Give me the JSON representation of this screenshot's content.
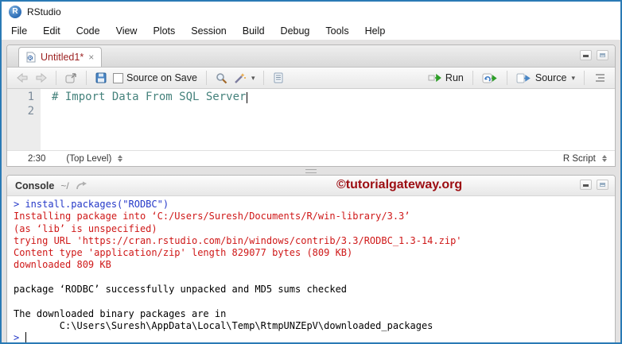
{
  "window": {
    "title": "RStudio"
  },
  "menu": {
    "items": [
      "File",
      "Edit",
      "Code",
      "View",
      "Plots",
      "Session",
      "Build",
      "Debug",
      "Tools",
      "Help"
    ]
  },
  "source_pane": {
    "tab": {
      "label": "Untitled1*",
      "close_glyph": "×"
    },
    "toolbar": {
      "source_on_save_label": "Source on Save",
      "run_label": "Run",
      "source_label": "Source"
    },
    "editor": {
      "lines": [
        {
          "number": "1",
          "code": "",
          "cursor": false
        },
        {
          "number": "2",
          "code": "# Import Data From SQL Server",
          "cursor": true
        }
      ]
    },
    "status": {
      "position": "2:30",
      "scope": "(Top Level)",
      "file_type": "R Script"
    }
  },
  "console_pane": {
    "title": "Console",
    "path": "~/",
    "watermark": "©tutorialgateway.org",
    "lines": [
      {
        "text": "> install.packages(\"RODBC\")",
        "color": "input",
        "cursor": false
      },
      {
        "text": "Installing package into ‘C:/Users/Suresh/Documents/R/win-library/3.3’",
        "color": "message",
        "cursor": false
      },
      {
        "text": "(as ‘lib’ is unspecified)",
        "color": "message",
        "cursor": false
      },
      {
        "text": "trying URL 'https://cran.rstudio.com/bin/windows/contrib/3.3/RODBC_1.3-14.zip'",
        "color": "message",
        "cursor": false
      },
      {
        "text": "Content type 'application/zip' length 829077 bytes (809 KB)",
        "color": "message",
        "cursor": false
      },
      {
        "text": "downloaded 809 KB",
        "color": "message",
        "cursor": false
      },
      {
        "text": "",
        "color": "output",
        "cursor": false
      },
      {
        "text": "package ‘RODBC’ successfully unpacked and MD5 sums checked",
        "color": "output",
        "cursor": false
      },
      {
        "text": "",
        "color": "output",
        "cursor": false
      },
      {
        "text": "The downloaded binary packages are in",
        "color": "output",
        "cursor": false
      },
      {
        "text": "        C:\\Users\\Suresh\\AppData\\Local\\Temp\\RtmpUNZEpV\\downloaded_packages",
        "color": "output",
        "cursor": false
      },
      {
        "text": "> ",
        "color": "input",
        "cursor": true
      }
    ]
  },
  "colors": {
    "input": "#2438c8",
    "message": "#cf1818",
    "output": "#000000",
    "comment": "#45827c",
    "window_border": "#2a7ab5",
    "tab_title": "#9b1f1f",
    "watermark": "#9c0d12"
  }
}
